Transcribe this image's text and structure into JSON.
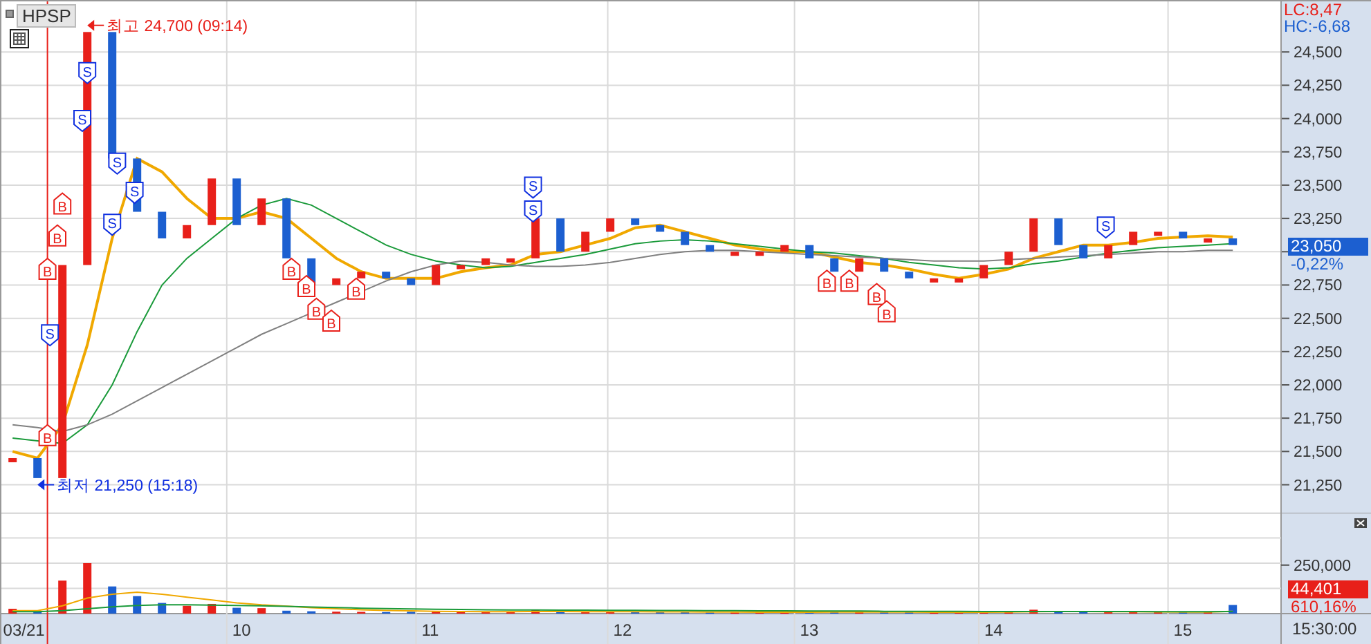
{
  "symbol_button": "HPSP",
  "indicators": [
    {
      "kind": "lc",
      "text": "LC:8,47"
    },
    {
      "kind": "hc",
      "text": "HC:-6,68"
    }
  ],
  "price_axis_upper": [
    "24,500",
    "24,250",
    "24,000",
    "23,750",
    "23,500",
    "23,250"
  ],
  "price_axis_lower": [
    "22,750",
    "22,500",
    "22,250",
    "22,000",
    "21,750",
    "21,500",
    "21,250"
  ],
  "volume_axis": [
    "250,000"
  ],
  "time_axis": [
    "03/21",
    "10",
    "11",
    "12",
    "13",
    "14",
    "15"
  ],
  "high_label": "최고 24,700 (09:14)",
  "low_label": "최저 21,250 (15:18)",
  "signals": [
    {
      "kind": "sell",
      "text": "S"
    },
    {
      "kind": "sell",
      "text": "S"
    },
    {
      "kind": "sell",
      "text": "S"
    },
    {
      "kind": "sell",
      "text": "S"
    },
    {
      "kind": "sell",
      "text": "S"
    },
    {
      "kind": "sell",
      "text": "S"
    },
    {
      "kind": "sell",
      "text": "S"
    },
    {
      "kind": "sell",
      "text": "S"
    },
    {
      "kind": "sell",
      "text": "S"
    },
    {
      "kind": "buy",
      "text": "B"
    },
    {
      "kind": "buy",
      "text": "B"
    },
    {
      "kind": "buy",
      "text": "B"
    },
    {
      "kind": "buy",
      "text": "B"
    },
    {
      "kind": "buy",
      "text": "B"
    },
    {
      "kind": "buy",
      "text": "B"
    },
    {
      "kind": "buy",
      "text": "B"
    },
    {
      "kind": "buy",
      "text": "B"
    },
    {
      "kind": "buy",
      "text": "B"
    },
    {
      "kind": "buy",
      "text": "B"
    },
    {
      "kind": "buy",
      "text": "B"
    },
    {
      "kind": "buy",
      "text": "B"
    },
    {
      "kind": "buy",
      "text": "B"
    }
  ],
  "last_price": {
    "text": "23,050",
    "change": "-0,22%"
  },
  "last_volume": {
    "text": "44,401",
    "change": "610,16%"
  },
  "time_label": "15:30:00"
}
